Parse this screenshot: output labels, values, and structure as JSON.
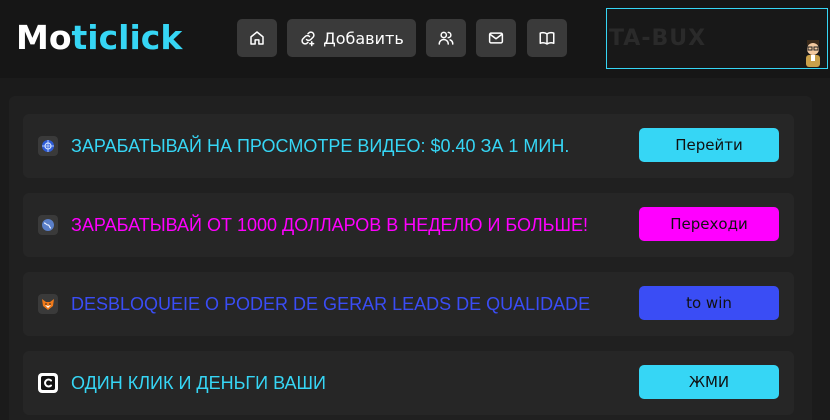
{
  "header": {
    "logo_part1": "Mo",
    "logo_part2": "ticlick",
    "nav": {
      "home_icon": "home-icon",
      "add_label": "Добавить",
      "add_icon": "link-add-icon",
      "users_icon": "users-icon",
      "mail_icon": "mail-icon",
      "book_icon": "book-icon"
    },
    "banner_text": "TA-BUX"
  },
  "colors": {
    "accent_cyan": "#36d6f5",
    "magenta": "#ff00ff",
    "blue": "#3a4df5",
    "background": "#1b1b1b"
  },
  "ads": [
    {
      "icon": "globe-blue-icon",
      "text": "ЗАРАБАТЫВАЙ НА ПРОСМОТРЕ ВИДЕО: $0.40 ЗА 1 МИН.",
      "text_color": "#36d6f5",
      "button_label": "Перейти",
      "button_color": "#36d6f5"
    },
    {
      "icon": "globe-icon",
      "text": "ЗАРАБАТЫВАЙ ОТ 1000 ДОЛЛАРОВ В НЕДЕЛЮ И БОЛЬШЕ!",
      "text_color": "#ff00ff",
      "button_label": "Переходи",
      "button_color": "#ff00ff"
    },
    {
      "icon": "fox-icon",
      "text": "DESBLOQUEIE O PODER DE GERAR LEADS DE QUALIDADE",
      "text_color": "#3a4df5",
      "button_label": "to win",
      "button_color": "#3a4df5"
    },
    {
      "icon": "c-logo-icon",
      "text": "ОДИН КЛИК И ДЕНЬГИ ВАШИ",
      "text_color": "#36d6f5",
      "button_label": "ЖМИ",
      "button_color": "#36d6f5"
    }
  ]
}
